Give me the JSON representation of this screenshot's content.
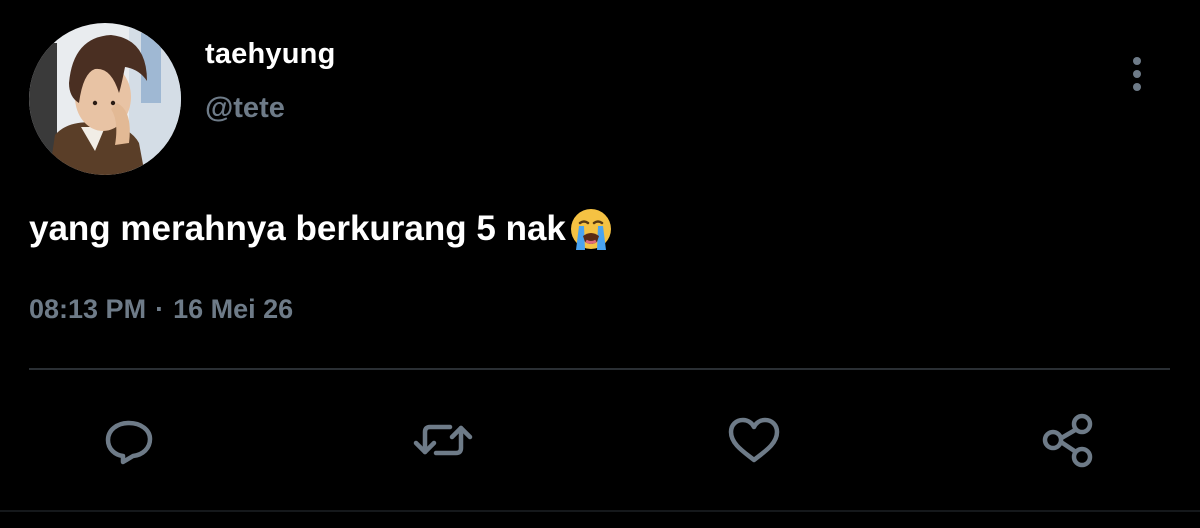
{
  "user": {
    "display_name": "taehyung",
    "handle": "@tete"
  },
  "tweet": {
    "text": "yang merahnya berkurang 5 nak",
    "emoji": "loudly-crying-face",
    "time": "08:13 PM",
    "separator": "·",
    "date": "16 Mei 26"
  },
  "actions": [
    "reply-icon",
    "retweet-icon",
    "like-icon",
    "share-icon"
  ],
  "colors": {
    "background": "#000000",
    "primary_text": "#ffffff",
    "secondary_text": "#6e7b88",
    "divider": "#2a2f34"
  }
}
